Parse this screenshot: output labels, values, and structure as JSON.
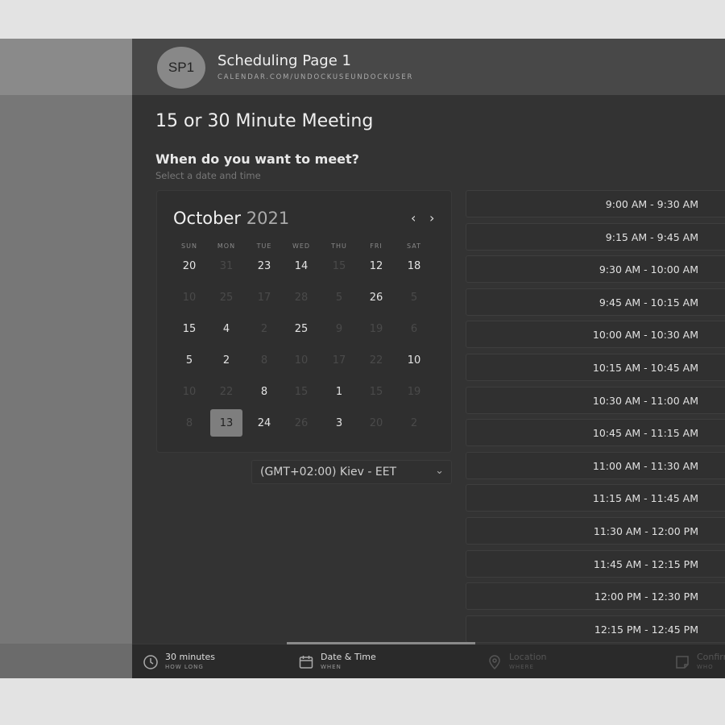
{
  "header": {
    "avatar_initials": "SP1",
    "page_name": "Scheduling Page 1",
    "page_url": "CALENDAR.COM/UNDOCKUSEUNDOCKUSER"
  },
  "meeting": {
    "title": "15 or 30 Minute Meeting",
    "prompt": "When do you want to meet?",
    "prompt_sub": "Select a date and time"
  },
  "calendar": {
    "month": "October",
    "year": "2021",
    "weekdays": [
      "SUN",
      "MON",
      "TUE",
      "WED",
      "THU",
      "FRI",
      "SAT"
    ],
    "rows": [
      [
        "20",
        "31",
        "23",
        "14",
        "15",
        "12",
        "18"
      ],
      [
        "10",
        "25",
        "17",
        "28",
        "5",
        "26",
        "5"
      ],
      [
        "15",
        "4",
        "2",
        "25",
        "9",
        "19",
        "6"
      ],
      [
        "5",
        "2",
        "8",
        "10",
        "17",
        "22",
        "10"
      ],
      [
        "10",
        "22",
        "8",
        "15",
        "1",
        "15",
        "19"
      ],
      [
        "8",
        "13",
        "24",
        "26",
        "3",
        "20",
        "2"
      ]
    ],
    "available": [
      [
        true,
        false,
        true,
        true,
        false,
        true,
        true
      ],
      [
        false,
        false,
        false,
        false,
        false,
        true,
        false
      ],
      [
        true,
        true,
        false,
        true,
        false,
        false,
        false
      ],
      [
        true,
        true,
        false,
        false,
        false,
        false,
        true
      ],
      [
        false,
        false,
        true,
        false,
        true,
        false,
        false
      ],
      [
        false,
        true,
        true,
        false,
        true,
        false,
        false
      ]
    ],
    "selected": "13"
  },
  "timezone": {
    "value": "(GMT+02:00) Kiev - EET"
  },
  "slots": [
    "9:00 AM - 9:30 AM",
    "9:15 AM - 9:45 AM",
    "9:30 AM - 10:00 AM",
    "9:45 AM - 10:15 AM",
    "10:00 AM - 10:30 AM",
    "10:15 AM - 10:45 AM",
    "10:30 AM - 11:00 AM",
    "10:45 AM - 11:15 AM",
    "11:00 AM - 11:30 AM",
    "11:15 AM - 11:45 AM",
    "11:30 AM - 12:00 PM",
    "11:45 AM - 12:15 PM",
    "12:00 PM - 12:30 PM",
    "12:15 PM - 12:45 PM"
  ],
  "steps": [
    {
      "label": "30 minutes",
      "sub": "HOW LONG",
      "icon": "clock-icon",
      "state": "done"
    },
    {
      "label": "Date & Time",
      "sub": "WHEN",
      "icon": "calendar-icon",
      "state": "active"
    },
    {
      "label": "Location",
      "sub": "WHERE",
      "icon": "location-pin-icon",
      "state": "dim"
    },
    {
      "label": "Confirm",
      "sub": "WHO",
      "icon": "note-icon",
      "state": "dim"
    }
  ]
}
